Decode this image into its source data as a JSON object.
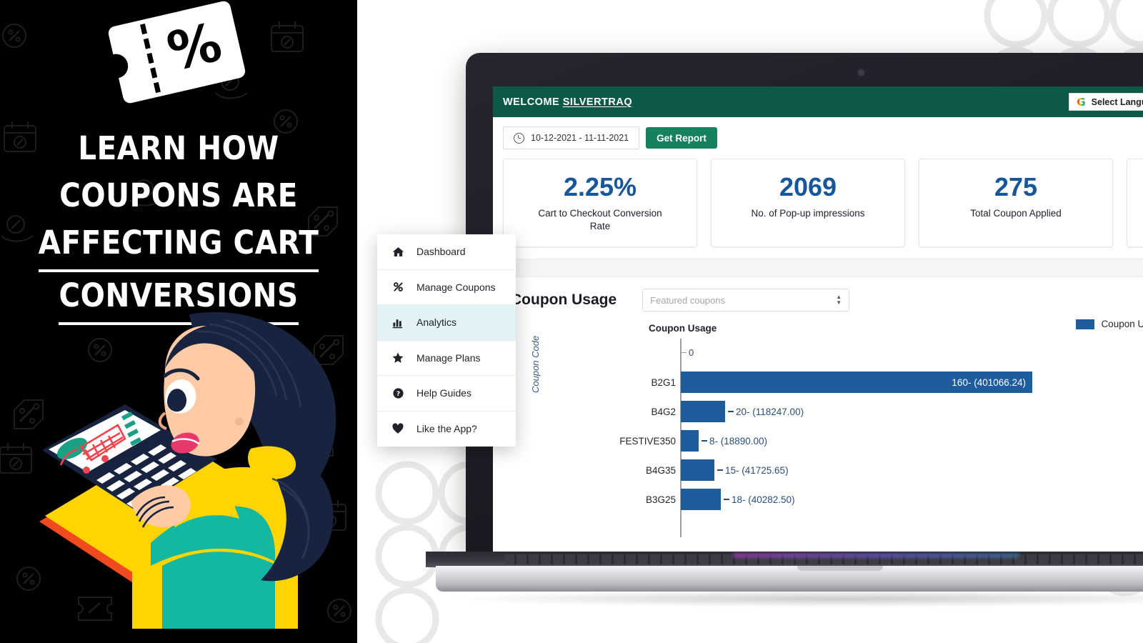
{
  "promo": {
    "icon": "coupon-ticket-percent-icon",
    "headline_lines": [
      "LEARN HOW",
      "COUPONS ARE",
      "AFFECTING CART",
      "CONVERSIONS"
    ],
    "illustration": "woman-at-laptop-shopping-cart-illustration"
  },
  "app": {
    "topbar": {
      "welcome_prefix": "WELCOME ",
      "store_name": "SILVERTRAQ",
      "translate_icon": "google-g-icon",
      "translate_label": "Select Language"
    },
    "toolbar": {
      "clock_icon": "clock-icon",
      "date_range": "10-12-2021  -  11-11-2021",
      "get_report_label": "Get Report"
    },
    "cards": [
      {
        "value": "2.25%",
        "label": "Cart to Checkout Conversion Rate"
      },
      {
        "value": "2069",
        "label": "No. of Pop-up impressions"
      },
      {
        "value": "275",
        "label": "Total Coupon Applied"
      },
      {
        "value": "",
        "label": ""
      }
    ],
    "panel": {
      "title": "Coupon Usage",
      "select_value": "Featured coupons",
      "select_icon": "stepper-chevrons-icon"
    },
    "menu": {
      "items": [
        {
          "label": "Dashboard",
          "icon": "home-icon",
          "active": false
        },
        {
          "label": "Manage Coupons",
          "icon": "percent-icon",
          "active": false
        },
        {
          "label": "Analytics",
          "icon": "bar-chart-icon",
          "active": true
        },
        {
          "label": "Manage Plans",
          "icon": "star-icon",
          "active": false
        },
        {
          "label": "Help Guides",
          "icon": "question-circle-icon",
          "active": false
        },
        {
          "label": "Like the App?",
          "icon": "heart-icon",
          "active": false
        }
      ]
    },
    "colors": {
      "topbar_green": "#0d5948",
      "button_green": "#17805f",
      "card_value_blue": "#17569b",
      "bar_blue": "#1f5c9e",
      "menu_active": "#e2f2f7"
    }
  },
  "chart_data": {
    "type": "bar",
    "orientation": "horizontal",
    "title": "Coupon Usage",
    "xlabel": "",
    "ylabel": "Coupon Code",
    "grid": false,
    "legend_position": "right",
    "legend": [
      "Coupon Used"
    ],
    "axis_origin_label": "0",
    "categories": [
      "",
      "B2G1",
      "B4G2",
      "FESTIVE350",
      "B4G35",
      "B3G25"
    ],
    "series": [
      {
        "name": "Coupon Used",
        "values": [
          0,
          160,
          20,
          8,
          15,
          18
        ]
      }
    ],
    "amounts": [
      null,
      401066.24,
      118247.0,
      18890.0,
      41725.65,
      40282.5
    ],
    "point_labels": [
      "0",
      "160- (401066.24)",
      "20- (118247.00)",
      "8- (18890.00)",
      "15- (41725.65)",
      "18- (40282.50)"
    ],
    "xlim": [
      0,
      160
    ]
  }
}
